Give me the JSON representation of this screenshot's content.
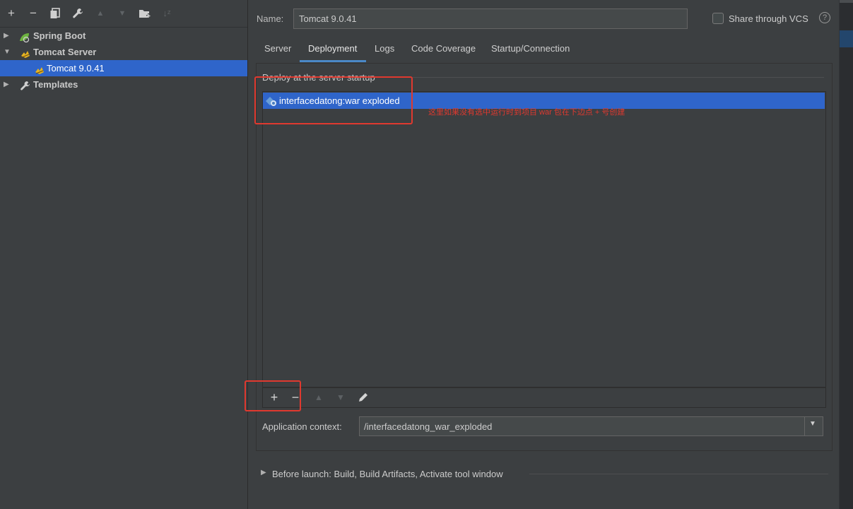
{
  "left_toolbar": {
    "icons": [
      "add-icon",
      "remove-icon",
      "copy-icon",
      "wrench-icon",
      "move-up-icon",
      "move-down-icon",
      "new-folder-icon",
      "sort-icon"
    ]
  },
  "tree": {
    "items": [
      {
        "label": "Spring Boot",
        "icon": "spring-boot-icon",
        "expanded": false
      },
      {
        "label": "Tomcat Server",
        "icon": "tomcat-icon",
        "expanded": true
      },
      {
        "label": "Tomcat 9.0.41",
        "icon": "tomcat-icon",
        "selected": true
      },
      {
        "label": "Templates",
        "icon": "wrench-icon",
        "expanded": false
      }
    ]
  },
  "config": {
    "name_label": "Name:",
    "name_value": "Tomcat 9.0.41",
    "share_label": "Share through VCS",
    "share_checked": false,
    "help_icon": "?"
  },
  "tabs": [
    {
      "label": "Server"
    },
    {
      "label": "Deployment",
      "active": true
    },
    {
      "label": "Logs"
    },
    {
      "label": "Code Coverage"
    },
    {
      "label": "Startup/Connection"
    }
  ],
  "deployment": {
    "section_label": "Deploy at the server startup",
    "artifacts": [
      {
        "label": "interfacedatong:war exploded",
        "selected": true
      }
    ],
    "annotation": "这里如果没有选中运行时到项目 war 包在下边点 + 号创建",
    "toolbar": {
      "add": "+",
      "remove": "−"
    }
  },
  "app_context": {
    "label": "Application context:",
    "value": "/interfacedatong_war_exploded"
  },
  "before_launch": {
    "label": "Before launch: Build, Build Artifacts, Activate tool window"
  },
  "colors": {
    "background": "#3c3f41",
    "selection": "#2f65ca",
    "annotation_red": "#e0392f",
    "tab_underline": "#4a88c7"
  }
}
